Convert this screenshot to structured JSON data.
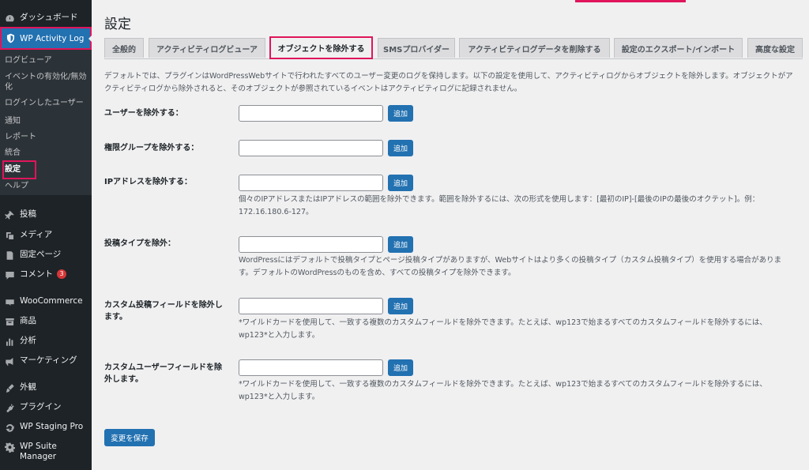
{
  "sidebar": {
    "dashboard": "ダッシュボード",
    "wp_activity_log": "WP Activity Log",
    "submenu": [
      "ログビューア",
      "イベントの有効化/無効化",
      "ログインしたユーザー",
      "通知",
      "レポート",
      "統合",
      "設定",
      "ヘルプ"
    ],
    "posts": "投稿",
    "media": "メディア",
    "pages": "固定ページ",
    "comments": "コメント",
    "comments_badge": "3",
    "woocommerce": "WooCommerce",
    "products": "商品",
    "analytics": "分析",
    "marketing": "マーケティング",
    "appearance": "外観",
    "plugins": "プラグイン",
    "wp_staging": "WP Staging Pro",
    "wp_suite": "WP Suite Manager"
  },
  "page": {
    "title": "設定",
    "tabs": [
      "全般的",
      "アクティビティログビューア",
      "オブジェクトを除外する",
      "SMSプロバイダー",
      "アクティビティログデータを削除する",
      "設定のエクスポート/インポート",
      "高度な設定"
    ],
    "description": "デフォルトでは、プラグインはWordPressWebサイトで行われたすべてのユーザー変更のログを保持します。以下の設定を使用して、アクティビティログからオブジェクトを除外します。オブジェクトがアクティビティログから除外されると、そのオブジェクトが参照されているイベントはアクティビティログに記録されません。",
    "add_label": "追加",
    "rows": [
      {
        "label": "ユーザーを除外する：",
        "help": ""
      },
      {
        "label": "権限グループを除外する：",
        "help": ""
      },
      {
        "label": "IPアドレスを除外する：",
        "help": "個々のIPアドレスまたはIPアドレスの範囲を除外できます。範囲を除外するには、次の形式を使用します：[最初のIP]-[最後のIPの最後のオクテット]。例：172.16.180.6-127。"
      },
      {
        "label": "投稿タイプを除外：",
        "help": "WordPressにはデフォルトで投稿タイプとページ投稿タイプがありますが、Webサイトはより多くの投稿タイプ（カスタム投稿タイプ）を使用する場合があります。デフォルトのWordPressのものを含め、すべての投稿タイプを除外できます。"
      },
      {
        "label": "カスタム投稿フィールドを除外します。",
        "help": "*ワイルドカードを使用して、一致する複数のカスタムフィールドを除外できます。たとえば、wp123で始まるすべてのカスタムフィールドを除外するには、wp123*と入力します。"
      },
      {
        "label": "カスタムユーザーフィールドを除外します。",
        "help": "*ワイルドカードを使用して、一致する複数のカスタムフィールドを除外できます。たとえば、wp123で始まるすべてのカスタムフィールドを除外するには、wp123*と入力します。"
      }
    ],
    "save_label": "変更を保存"
  },
  "colors": {
    "sidebar_bg": "#1d2327",
    "accent_blue": "#2271b1",
    "highlight": "#e0155b"
  }
}
